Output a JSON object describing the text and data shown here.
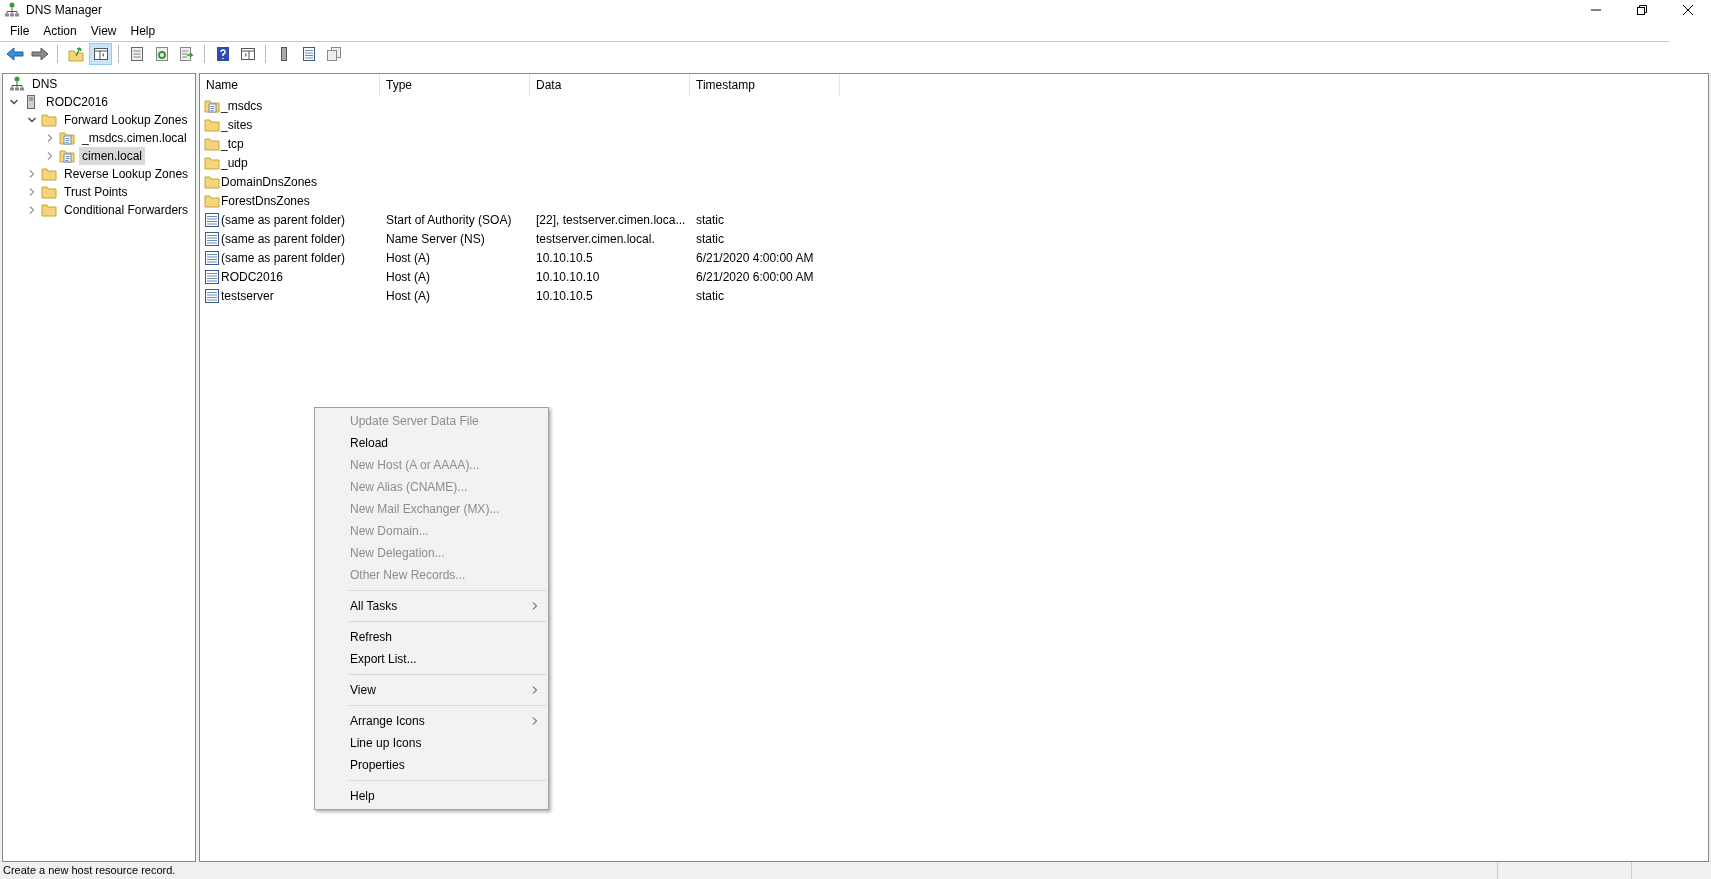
{
  "window": {
    "title": "DNS Manager"
  },
  "menu_bar": [
    "File",
    "Action",
    "View",
    "Help"
  ],
  "toolbar": [
    {
      "kind": "back",
      "pressed": false
    },
    {
      "kind": "forward",
      "pressed": false
    },
    {
      "kind": "sep"
    },
    {
      "kind": "up",
      "pressed": false
    },
    {
      "kind": "tree",
      "pressed": true
    },
    {
      "kind": "sep"
    },
    {
      "kind": "properties",
      "pressed": false
    },
    {
      "kind": "refresh",
      "pressed": false
    },
    {
      "kind": "export",
      "pressed": false
    },
    {
      "kind": "sep"
    },
    {
      "kind": "help",
      "pressed": false
    },
    {
      "kind": "action",
      "pressed": false
    },
    {
      "kind": "sep"
    },
    {
      "kind": "server",
      "pressed": false
    },
    {
      "kind": "list",
      "pressed": false
    },
    {
      "kind": "copy",
      "pressed": false
    }
  ],
  "tree": [
    {
      "label": "DNS",
      "kind": "dns",
      "selected": false,
      "children": [
        {
          "label": "RODC2016",
          "kind": "server",
          "selected": false,
          "expanded": true,
          "children": [
            {
              "label": "Forward Lookup Zones",
              "kind": "folder",
              "selected": false,
              "expanded": true,
              "children": [
                {
                  "label": "_msdcs.cimen.local",
                  "kind": "zone",
                  "selected": false,
                  "expanded": false
                },
                {
                  "label": "cimen.local",
                  "kind": "zone",
                  "selected": true,
                  "expanded": false
                }
              ]
            },
            {
              "label": "Reverse Lookup Zones",
              "kind": "folder",
              "selected": false,
              "expanded": false
            },
            {
              "label": "Trust Points",
              "kind": "folder",
              "selected": false,
              "expanded": false
            },
            {
              "label": "Conditional Forwarders",
              "kind": "folder",
              "selected": false,
              "expanded": false
            }
          ]
        }
      ]
    }
  ],
  "table": {
    "columns": [
      "Name",
      "Type",
      "Data",
      "Timestamp"
    ],
    "rows": [
      {
        "kind": "zone",
        "cells": [
          "_msdcs",
          "",
          "",
          ""
        ]
      },
      {
        "kind": "folder",
        "cells": [
          "_sites",
          "",
          "",
          ""
        ]
      },
      {
        "kind": "folder",
        "cells": [
          "_tcp",
          "",
          "",
          ""
        ]
      },
      {
        "kind": "folder",
        "cells": [
          "_udp",
          "",
          "",
          ""
        ]
      },
      {
        "kind": "folder",
        "cells": [
          "DomainDnsZones",
          "",
          "",
          ""
        ]
      },
      {
        "kind": "folder",
        "cells": [
          "ForestDnsZones",
          "",
          "",
          ""
        ]
      },
      {
        "kind": "record",
        "cells": [
          "(same as parent folder)",
          "Start of Authority (SOA)",
          "[22], testserver.cimen.loca...",
          "static"
        ]
      },
      {
        "kind": "record",
        "cells": [
          "(same as parent folder)",
          "Name Server (NS)",
          "testserver.cimen.local.",
          "static"
        ]
      },
      {
        "kind": "record",
        "cells": [
          "(same as parent folder)",
          "Host (A)",
          "10.10.10.5",
          "6/21/2020 4:00:00 AM"
        ]
      },
      {
        "kind": "record",
        "cells": [
          "RODC2016",
          "Host (A)",
          "10.10.10.10",
          "6/21/2020 6:00:00 AM"
        ]
      },
      {
        "kind": "record",
        "cells": [
          "testserver",
          "Host (A)",
          "10.10.10.5",
          "static"
        ]
      }
    ]
  },
  "context_menu": [
    {
      "kind": "item",
      "label": "Update Server Data File",
      "disabled": true,
      "submenu": false
    },
    {
      "kind": "item",
      "label": "Reload",
      "disabled": false,
      "submenu": false
    },
    {
      "kind": "item",
      "label": "New Host (A or AAAA)...",
      "disabled": true,
      "submenu": false
    },
    {
      "kind": "item",
      "label": "New Alias (CNAME)...",
      "disabled": true,
      "submenu": false
    },
    {
      "kind": "item",
      "label": "New Mail Exchanger (MX)...",
      "disabled": true,
      "submenu": false
    },
    {
      "kind": "item",
      "label": "New Domain...",
      "disabled": true,
      "submenu": false
    },
    {
      "kind": "item",
      "label": "New Delegation...",
      "disabled": true,
      "submenu": false
    },
    {
      "kind": "item",
      "label": "Other New Records...",
      "disabled": true,
      "submenu": false
    },
    {
      "kind": "separator"
    },
    {
      "kind": "item",
      "label": "All Tasks",
      "disabled": false,
      "submenu": true
    },
    {
      "kind": "separator"
    },
    {
      "kind": "item",
      "label": "Refresh",
      "disabled": false,
      "submenu": false
    },
    {
      "kind": "item",
      "label": "Export List...",
      "disabled": false,
      "submenu": false
    },
    {
      "kind": "separator"
    },
    {
      "kind": "item",
      "label": "View",
      "disabled": false,
      "submenu": true
    },
    {
      "kind": "separator"
    },
    {
      "kind": "item",
      "label": "Arrange Icons",
      "disabled": false,
      "submenu": true
    },
    {
      "kind": "item",
      "label": "Line up Icons",
      "disabled": false,
      "submenu": false
    },
    {
      "kind": "item",
      "label": "Properties",
      "disabled": false,
      "submenu": false
    },
    {
      "kind": "separator"
    },
    {
      "kind": "item",
      "label": "Help",
      "disabled": false,
      "submenu": false
    }
  ],
  "status_bar": {
    "text": "Create a new host resource record."
  }
}
